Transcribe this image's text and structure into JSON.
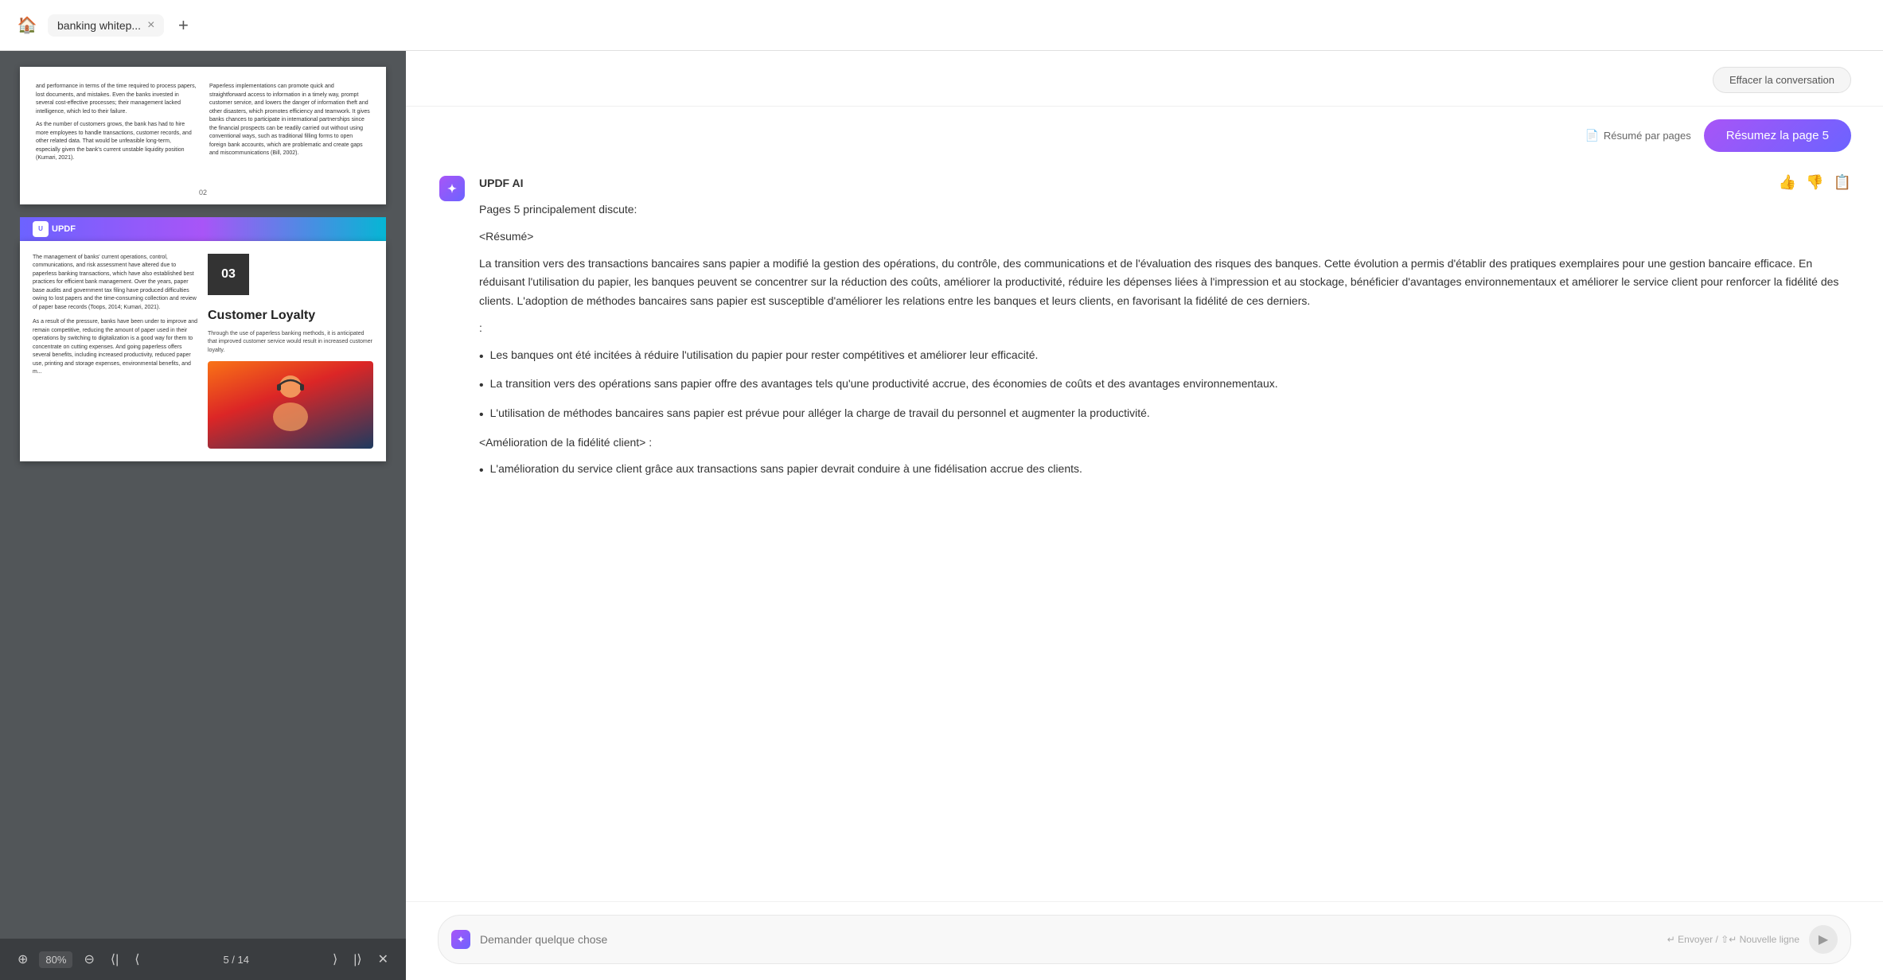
{
  "topBar": {
    "homeIcon": "🏠",
    "tab": {
      "label": "banking whitep...",
      "closeIcon": "×"
    },
    "addTabIcon": "+"
  },
  "pdfViewer": {
    "page2": {
      "leftCol": "and performance in terms of the time required to process papers, lost documents, and mistakes. Even the banks invested in several cost-effective processes; their management lacked intelligence, which led to their failure.\n\nAs the number of customers grows, the bank has had to hire more employees to handle transactions, customer records, and other related data. That would be unfeasible long-term, especially given the bank's current unstable liquidity position (Kumari, 2021).",
      "rightCol": "Paperless implementations can promote quick and straightforward access to information in a timely way, prompt customer service, and lowers the danger of information theft and other disasters, which promotes efficiency and teamwork. It gives banks chances to participate in international partnerships since the financial prospects can be readily carried out without using conventional ways, such as traditional filling forms to open foreign bank accounts, which are problematic and create gaps and miscommunications (Bill, 2002).",
      "pageNumber": "02"
    },
    "page3": {
      "chapterNumber": "03",
      "chapterTitle": "Customer Loyalty",
      "chapterDesc": "Through the use of paperless banking methods, it is anticipated that improved customer service would result in increased customer loyalty.",
      "leftText": "The management of banks' current operations, control, communications, and risk assessment have altered due to paperless banking transactions, which have also established best practices for efficient bank management. Over the years, paper base audits and government tax filing have produced difficulties owing to lost papers and the time-consuming collection and review of paper base records (Toops, 2014; Kumari, 2021).\n\nAs a result of the pressure, banks have been under to improve and remain competitive, reducing the amount of paper used in their operations by switching to digitalization is a good way for them to concentrate on cutting expenses. And going paperless offers several benefits, including increased productivity, reduced paper use, printing and storage expenses, environmental benefits, and m..."
    },
    "toolbar": {
      "zoomOut": "−",
      "zoomLevel": "80%",
      "zoomIn": "+",
      "navFirst": "⟨⟨",
      "navPrev": "⟨",
      "currentPage": "5",
      "totalPages": "14",
      "navNext": "⟩",
      "navLast": "⟩⟩",
      "close": "✕"
    }
  },
  "aiPanel": {
    "clearButton": "Effacer la conversation",
    "summaryLabel": "Résumé par pages",
    "summaryDocIcon": "📄",
    "summarizeButton": "Résumez la page 5",
    "brandName": "UPDF AI",
    "brandIcon": "✦",
    "messageHeader": "Pages 5 principalement discute:",
    "resumeTag": "<Résumé>",
    "mainSummary": "La transition vers des transactions bancaires sans papier a modifié la gestion des opérations, du contrôle, des communications et de l'évaluation des risques des banques. Cette évolution a permis d'établir des pratiques exemplaires pour une gestion bancaire efficace. En réduisant l'utilisation du papier, les banques peuvent se concentrer sur la réduction des coûts, améliorer la productivité, réduire les dépenses liées à l'impression et au stockage, bénéficier d'avantages environnementaux et améliorer le service client pour renforcer la fidélité des clients. L'adoption de méthodes bancaires sans papier est susceptible d'améliorer les relations entre les banques et leurs clients, en favorisant la fidélité de ces derniers.",
    "colonLine": ":",
    "bullets": [
      "Les banques ont été incitées à réduire l'utilisation du papier pour rester compétitives et améliorer leur efficacité.",
      "La transition vers des opérations sans papier offre des avantages tels qu'une productivité accrue, des économies de coûts et des avantages environnementaux.",
      "L'utilisation de méthodes bancaires sans papier est prévue pour alléger la charge de travail du personnel et augmenter la productivité."
    ],
    "loyaltyTag": "<Amélioration de la fidélité client> :",
    "loyaltyBullet": "L'amélioration du service client grâce aux transactions sans papier devrait conduire à une fidélisation accrue des clients.",
    "inputPlaceholder": "Demander quelque chose",
    "inputHint": "↵ Envoyer / ⇧↵ Nouvelle ligne",
    "thumbUpIcon": "👍",
    "thumbDownIcon": "👎",
    "copyIcon": "📋"
  }
}
